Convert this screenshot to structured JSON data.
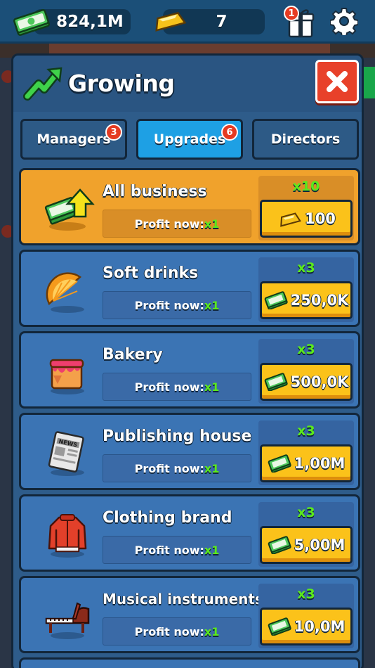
{
  "topbar": {
    "cash_value": "824,1M",
    "gold_value": "7",
    "gift_badge": "1"
  },
  "panel": {
    "title": "Growing",
    "tabs": [
      {
        "label": "Managers",
        "badge": "3",
        "active": false
      },
      {
        "label": "Upgrades",
        "badge": "6",
        "active": true
      },
      {
        "label": "Directors",
        "badge": "",
        "active": false
      }
    ],
    "profit_prefix": "Profit now: ",
    "rows": [
      {
        "name": "All business",
        "profit_mult": "x1",
        "mult": "x10",
        "price": "100",
        "currency": "gold",
        "icon": "cash-upgrade-icon"
      },
      {
        "name": "Soft drinks",
        "profit_mult": "x1",
        "mult": "x3",
        "price": "250,0K",
        "currency": "cash",
        "icon": "orange-slice-icon"
      },
      {
        "name": "Bakery",
        "profit_mult": "x1",
        "mult": "x3",
        "price": "500,0K",
        "currency": "cash",
        "icon": "cake-icon"
      },
      {
        "name": "Publishing house",
        "profit_mult": "x1",
        "mult": "x3",
        "price": "1,00M",
        "currency": "cash",
        "icon": "newspaper-icon"
      },
      {
        "name": "Clothing brand",
        "profit_mult": "x1",
        "mult": "x3",
        "price": "5,00M",
        "currency": "cash",
        "icon": "jacket-icon"
      },
      {
        "name": "Musical instruments",
        "profit_mult": "x1",
        "mult": "x3",
        "price": "10,0M",
        "currency": "cash",
        "icon": "piano-icon"
      }
    ],
    "newspaper_text": "NEWS"
  },
  "colors": {
    "accent_blue": "#1ea0e4",
    "close_red": "#e8412a",
    "button_gold": "#fbc21a",
    "multiplier_green": "#5bea1c",
    "row_blue": "#3b74b4",
    "row_gold": "#f0a22c"
  }
}
